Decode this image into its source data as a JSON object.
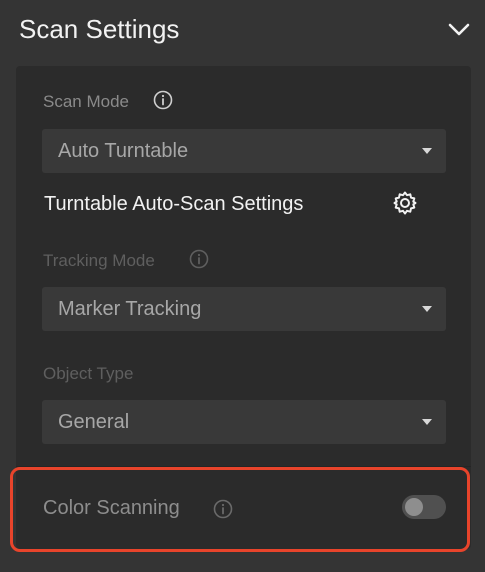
{
  "header": {
    "title": "Scan Settings",
    "collapse_icon": "chevron-down-icon"
  },
  "scan_mode": {
    "label": "Scan Mode",
    "info_icon": "info-icon",
    "value": "Auto Turntable"
  },
  "auto_scan": {
    "title": "Turntable Auto-Scan Settings",
    "icon": "gear-icon"
  },
  "tracking_mode": {
    "label": "Tracking Mode",
    "info_icon": "info-icon",
    "value": "Marker Tracking"
  },
  "object_type": {
    "label": "Object Type",
    "value": "General"
  },
  "color_scanning": {
    "label": "Color Scanning",
    "info_icon": "info-icon",
    "enabled": false
  },
  "colors": {
    "highlight": "#e8442b",
    "background": "#343434",
    "panel": "#2b2b2b"
  }
}
